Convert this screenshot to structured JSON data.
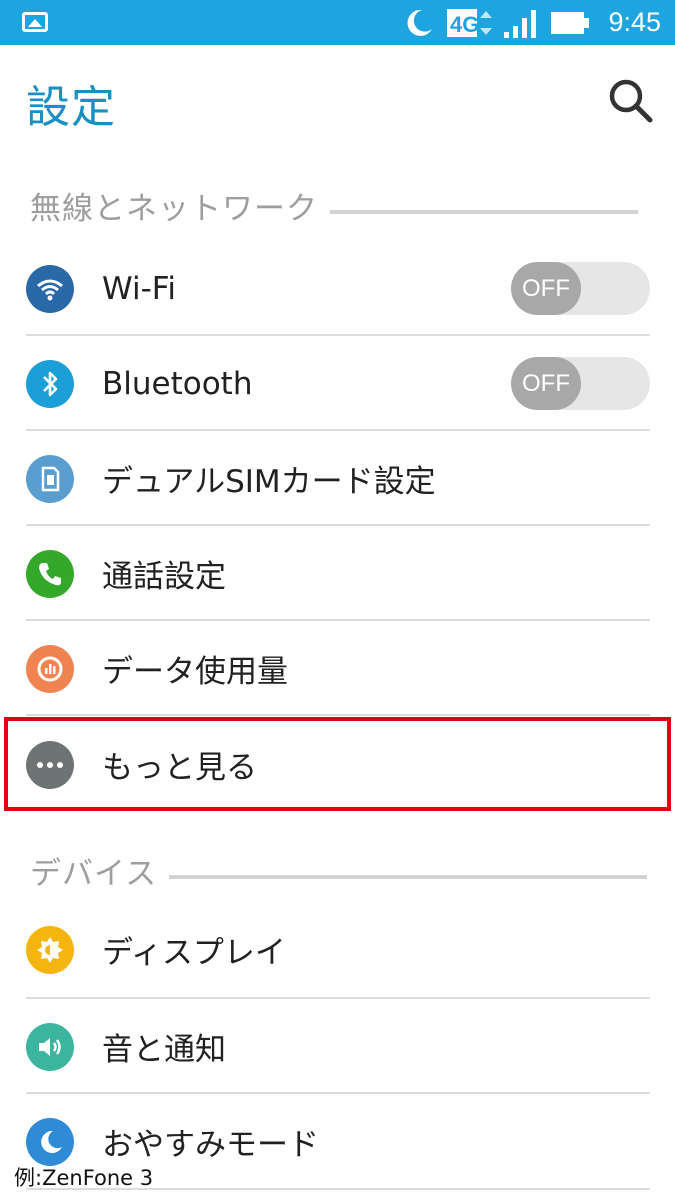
{
  "status_bar": {
    "network": "4G",
    "time": "9:45",
    "icons": [
      "picture-icon",
      "moon-icon",
      "lte-icon",
      "signal-icon",
      "battery-icon"
    ]
  },
  "header": {
    "title": "設定",
    "search_icon": "search-icon"
  },
  "sections": {
    "wireless": {
      "title": "無線とネットワーク",
      "items": [
        {
          "label": "Wi-Fi",
          "icon": "wifi-icon",
          "color": "#2a69a8",
          "toggle": "OFF"
        },
        {
          "label": "Bluetooth",
          "icon": "bluetooth-icon",
          "color": "#1c9ed6",
          "toggle": "OFF"
        },
        {
          "label": "デュアルSIMカード設定",
          "icon": "sim-card-icon",
          "color": "#5a9ed0"
        },
        {
          "label": "通話設定",
          "icon": "phone-icon",
          "color": "#34a82a"
        },
        {
          "label": "データ使用量",
          "icon": "data-usage-icon",
          "color": "#ef8450"
        },
        {
          "label": "もっと見る",
          "icon": "more-icon",
          "color": "#6e7474"
        }
      ]
    },
    "device": {
      "title": "デバイス",
      "items": [
        {
          "label": "ディスプレイ",
          "icon": "brightness-icon",
          "color": "#f4b50e"
        },
        {
          "label": "音と通知",
          "icon": "sound-icon",
          "color": "#3cb59f"
        },
        {
          "label": "おやすみモード",
          "icon": "moon-icon",
          "color": "#2f8bd6"
        }
      ]
    }
  },
  "highlight_color": "#e60012",
  "footnote": "例:ZenFone 3"
}
